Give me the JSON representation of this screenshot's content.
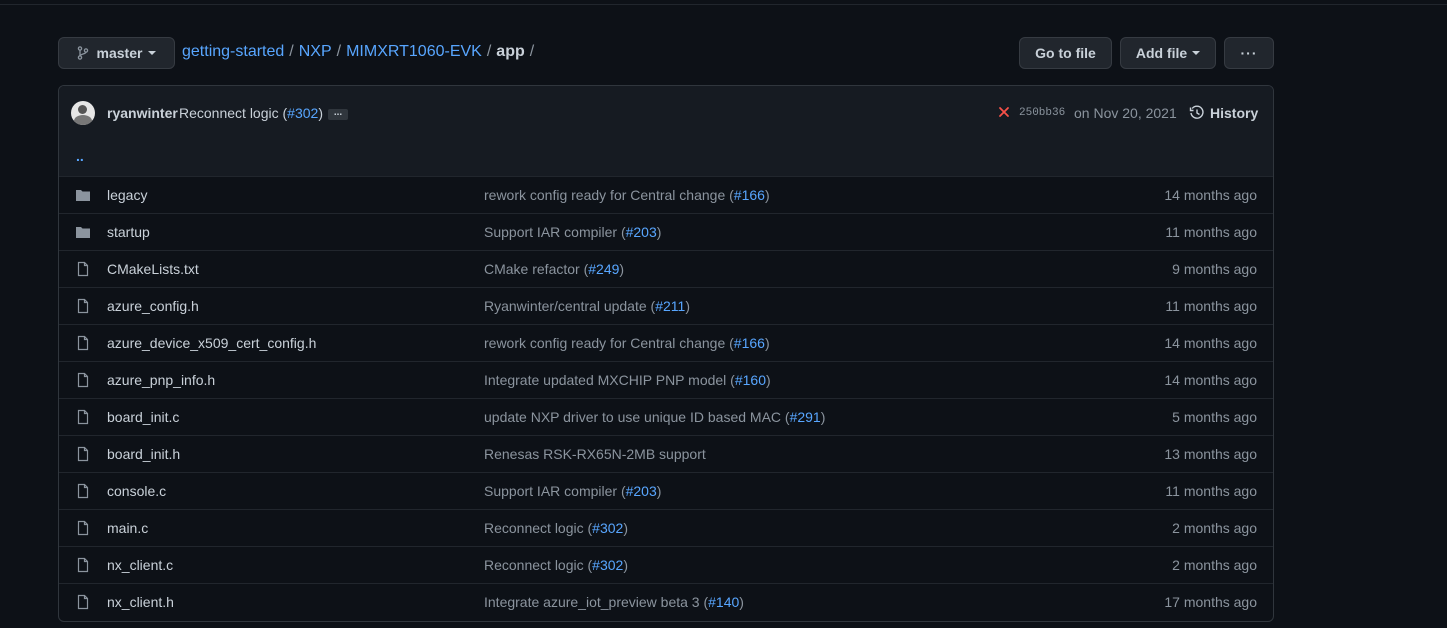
{
  "branch": {
    "label": "master"
  },
  "breadcrumb": {
    "repo": "getting-started",
    "parts": [
      "NXP",
      "MIMXRT1060-EVK"
    ],
    "current": "app",
    "separator": "/"
  },
  "actions": {
    "goto_label": "Go to file",
    "addfile_label": "Add file",
    "more_label": "···"
  },
  "commit": {
    "author": "ryanwinter",
    "message": "Reconnect logic (",
    "pr": "#302",
    "message_end": ")",
    "ellipsis": "...",
    "status_icon": "x-icon",
    "status_color": "#f85149",
    "sha": "250bb36",
    "date": "on Nov 20, 2021",
    "history_label": "History"
  },
  "parent_dir": "..",
  "colors": {
    "link": "#58a6ff",
    "background": "#0d1117",
    "folder": "#8b949e"
  },
  "files": [
    {
      "type": "dir",
      "name": "legacy",
      "msg": "rework config ready for Central change (",
      "pr": "#166",
      "end": ")",
      "age": "14 months ago"
    },
    {
      "type": "dir",
      "name": "startup",
      "msg": "Support IAR compiler (",
      "pr": "#203",
      "end": ")",
      "age": "11 months ago"
    },
    {
      "type": "file",
      "name": "CMakeLists.txt",
      "msg": "CMake refactor (",
      "pr": "#249",
      "end": ")",
      "age": "9 months ago"
    },
    {
      "type": "file",
      "name": "azure_config.h",
      "msg": "Ryanwinter/central update (",
      "pr": "#211",
      "end": ")",
      "age": "11 months ago"
    },
    {
      "type": "file",
      "name": "azure_device_x509_cert_config.h",
      "msg": "rework config ready for Central change (",
      "pr": "#166",
      "end": ")",
      "age": "14 months ago"
    },
    {
      "type": "file",
      "name": "azure_pnp_info.h",
      "msg": "Integrate updated MXCHIP PNP model (",
      "pr": "#160",
      "end": ")",
      "age": "14 months ago"
    },
    {
      "type": "file",
      "name": "board_init.c",
      "msg": "update NXP driver to use unique ID based MAC (",
      "pr": "#291",
      "end": ")",
      "age": "5 months ago"
    },
    {
      "type": "file",
      "name": "board_init.h",
      "msg": "Renesas RSK-RX65N-2MB support",
      "pr": "",
      "end": "",
      "age": "13 months ago"
    },
    {
      "type": "file",
      "name": "console.c",
      "msg": "Support IAR compiler (",
      "pr": "#203",
      "end": ")",
      "age": "11 months ago"
    },
    {
      "type": "file",
      "name": "main.c",
      "msg": "Reconnect logic (",
      "pr": "#302",
      "end": ")",
      "age": "2 months ago"
    },
    {
      "type": "file",
      "name": "nx_client.c",
      "msg": "Reconnect logic (",
      "pr": "#302",
      "end": ")",
      "age": "2 months ago"
    },
    {
      "type": "file",
      "name": "nx_client.h",
      "msg": "Integrate azure_iot_preview beta 3 (",
      "pr": "#140",
      "end": ")",
      "age": "17 months ago"
    }
  ]
}
